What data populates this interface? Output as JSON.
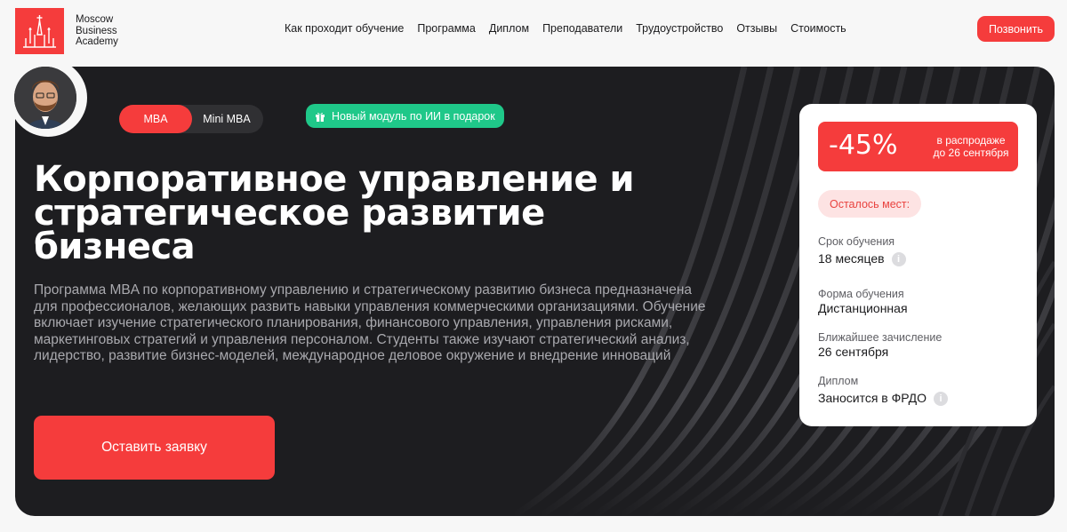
{
  "header": {
    "logo_text": "Moscow Business Academy",
    "nav": [
      {
        "label": "Как проходит обучение"
      },
      {
        "label": "Программа"
      },
      {
        "label": "Диплом"
      },
      {
        "label": "Преподаватели"
      },
      {
        "label": "Трудоустройство"
      },
      {
        "label": "Отзывы"
      },
      {
        "label": "Стоимость"
      }
    ],
    "call_label": "Позвонить"
  },
  "hero": {
    "tabs": [
      {
        "label": "MBA",
        "active": true
      },
      {
        "label": "Mini MBA",
        "active": false
      }
    ],
    "promo": "Новый модуль по ИИ в подарок",
    "title": "Корпоративное управление и стратегическое развитие бизнеса",
    "description": "Программа MBA по корпоративному управлению и стратегическому развитию бизнеса предназначена для профессионалов, желающих развить навыки управления коммерческими организациями. Обучение включает изучение стратегического планирования, финансового управления, управления рисками, маркетинговых стратегий и управления персоналом. Студенты также изучают стратегический анализ, лидерство, развитие бизнес-моделей, международное деловое окружение и внедрение инноваций",
    "apply_label": "Оставить заявку"
  },
  "info": {
    "discount": "-45%",
    "sale_text": "в распродаже до 26 сентября",
    "seats": "Осталось мест:",
    "duration_label": "Срок обучения",
    "duration_value": "18 месяцев",
    "format_label": "Форма обучения",
    "format_value": "Дистанционная",
    "enrollment_label": "Ближайшее зачисление",
    "enrollment_value": "26 сентября",
    "diploma_label": "Диплом",
    "diploma_value": "Заносится в ФРДО"
  },
  "colors": {
    "accent": "#f53c3c",
    "hero_bg": "#1d1d20",
    "promo": "#1fc889"
  },
  "icons": [
    "kremlin-logo-icon",
    "gift-icon",
    "info-icon"
  ]
}
